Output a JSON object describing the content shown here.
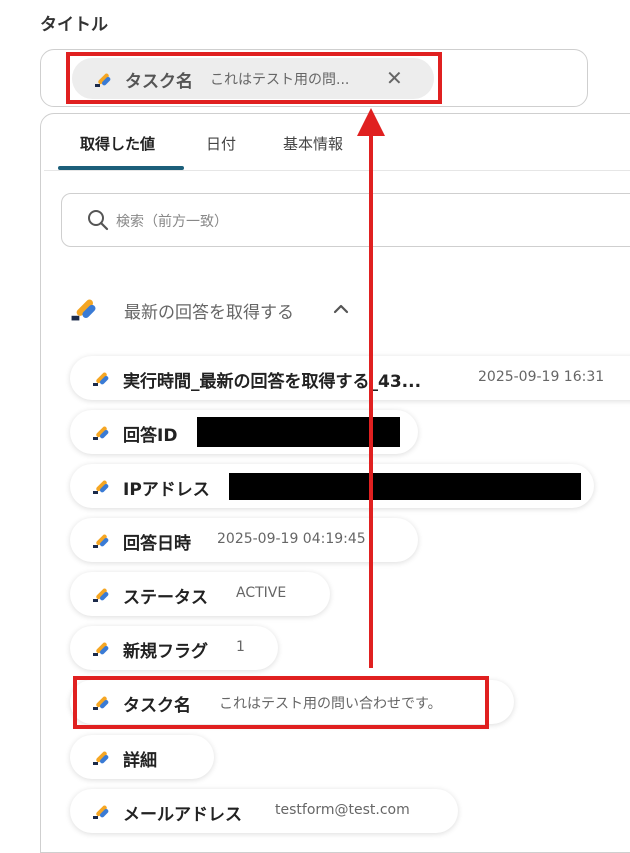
{
  "field_label": "タイトル",
  "title_chip": {
    "name": "タスク名",
    "value": "これはテスト用の問...",
    "close_icon": "close-icon"
  },
  "tabs": [
    {
      "label": "取得した値",
      "active": true
    },
    {
      "label": "日付",
      "active": false
    },
    {
      "label": "基本情報",
      "active": false
    }
  ],
  "search": {
    "placeholder": "検索（前方一致）",
    "icon": "search-icon"
  },
  "section": {
    "title": "最新の回答を取得する",
    "expanded": true
  },
  "items": [
    {
      "name": "実行時間_最新の回答を取得する_43...",
      "value": "2025-09-19 16:31"
    },
    {
      "name": "回答ID",
      "value": "",
      "redacted": true
    },
    {
      "name": "IPアドレス",
      "value": "",
      "redacted": true
    },
    {
      "name": "回答日時",
      "value": "2025-09-19 04:19:45"
    },
    {
      "name": "ステータス",
      "value": "ACTIVE"
    },
    {
      "name": "新規フラグ",
      "value": "1"
    },
    {
      "name": "タスク名",
      "value": "これはテスト用の問い合わせです。",
      "highlighted": true
    },
    {
      "name": "詳細",
      "value": ""
    },
    {
      "name": "メールアドレス",
      "value": "testform@test.com"
    }
  ],
  "colors": {
    "accent": "#1c5f7a",
    "highlight": "#e02020",
    "logo_orange": "#f5a623",
    "logo_blue": "#3a7bd5",
    "logo_navy": "#1b2a4a"
  }
}
